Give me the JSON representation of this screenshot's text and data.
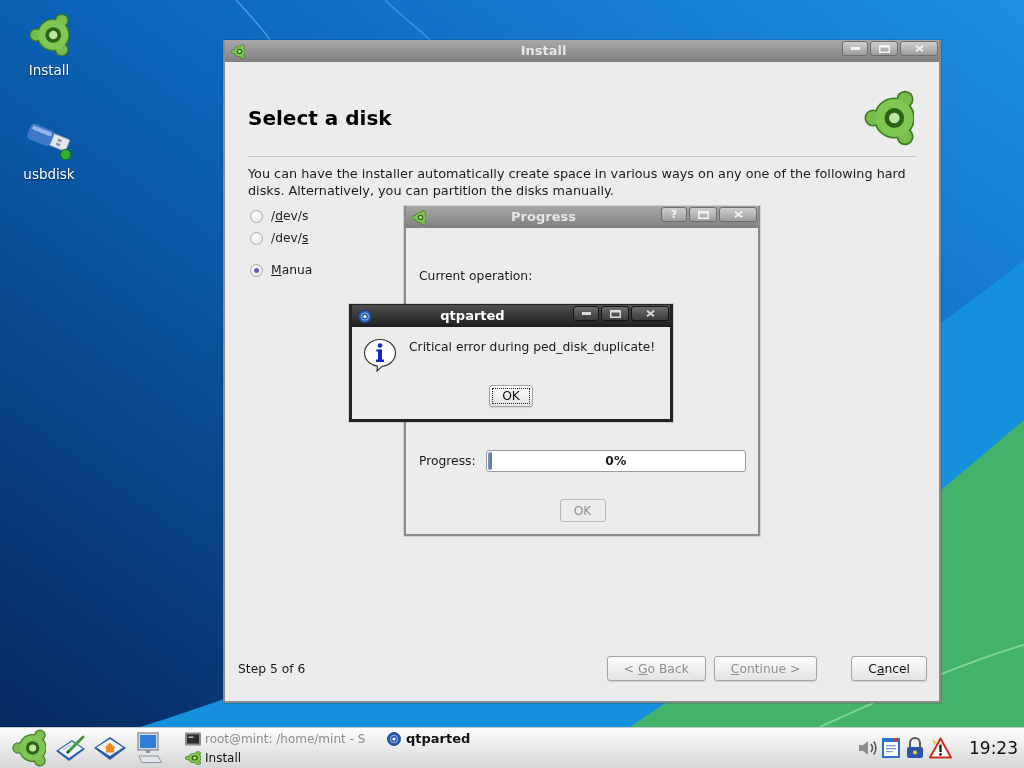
{
  "desktop_icons": [
    {
      "label": "Install",
      "kind": "installer"
    },
    {
      "label": "usbdisk",
      "kind": "usb"
    }
  ],
  "install_window": {
    "title": "Install",
    "active": false,
    "controls": [
      {
        "kind": "minimize"
      },
      {
        "kind": "maximize"
      },
      {
        "kind": "close"
      }
    ],
    "heading": "Select a disk",
    "description": "You can have the installer automatically create space in various ways on any one of the following hard disks. Alternatively, you can partition the disks manually.",
    "options": [
      {
        "label": {
          "pre": "/",
          "key": "d",
          "post": "ev/s"
        },
        "selected": false
      },
      {
        "label": {
          "pre": "/dev/",
          "key": "s"
        },
        "selected": false
      },
      {
        "label": {
          "key": "M",
          "post": "anua"
        },
        "selected": true
      }
    ],
    "step": "Step 5 of 6",
    "buttons": [
      {
        "label": {
          "pre": "< ",
          "key": "G",
          "post": "o Back"
        },
        "disabled": true
      },
      {
        "label": {
          "key": "C",
          "post": "ontinue >"
        },
        "disabled": true
      },
      {
        "label": {
          "pre": "C",
          "key": "a",
          "post": "ncel"
        },
        "disabled": false
      }
    ]
  },
  "progress_window": {
    "title": "Progress",
    "active": false,
    "controls": [
      {
        "kind": "help",
        "glyph": "?"
      },
      {
        "kind": "maximize"
      },
      {
        "kind": "close"
      }
    ],
    "operation_label": "Current operation:",
    "progress_label": "Progress:",
    "progress": {
      "level": 0,
      "reading": "0%"
    },
    "ok_button": {
      "label": "OK",
      "disabled": true
    }
  },
  "error_dialog": {
    "title": "qtparted",
    "active": true,
    "controls": [
      {
        "kind": "minimize"
      },
      {
        "kind": "maximize"
      },
      {
        "kind": "close"
      }
    ],
    "message": "Critical error during ped_disk_duplicate!",
    "ok_button": {
      "label": "OK",
      "focused": true
    }
  },
  "taskbar": {
    "tasks": [
      {
        "label": "root@mint: /home/mint - S",
        "kind": "terminal",
        "selected": false,
        "minimized": true
      },
      {
        "label": "qtparted",
        "kind": "dialog",
        "selected": true,
        "minimized": false
      },
      {
        "label": "Install",
        "kind": "installer",
        "selected": false,
        "minimized": false
      }
    ],
    "clock": "19:23"
  }
}
